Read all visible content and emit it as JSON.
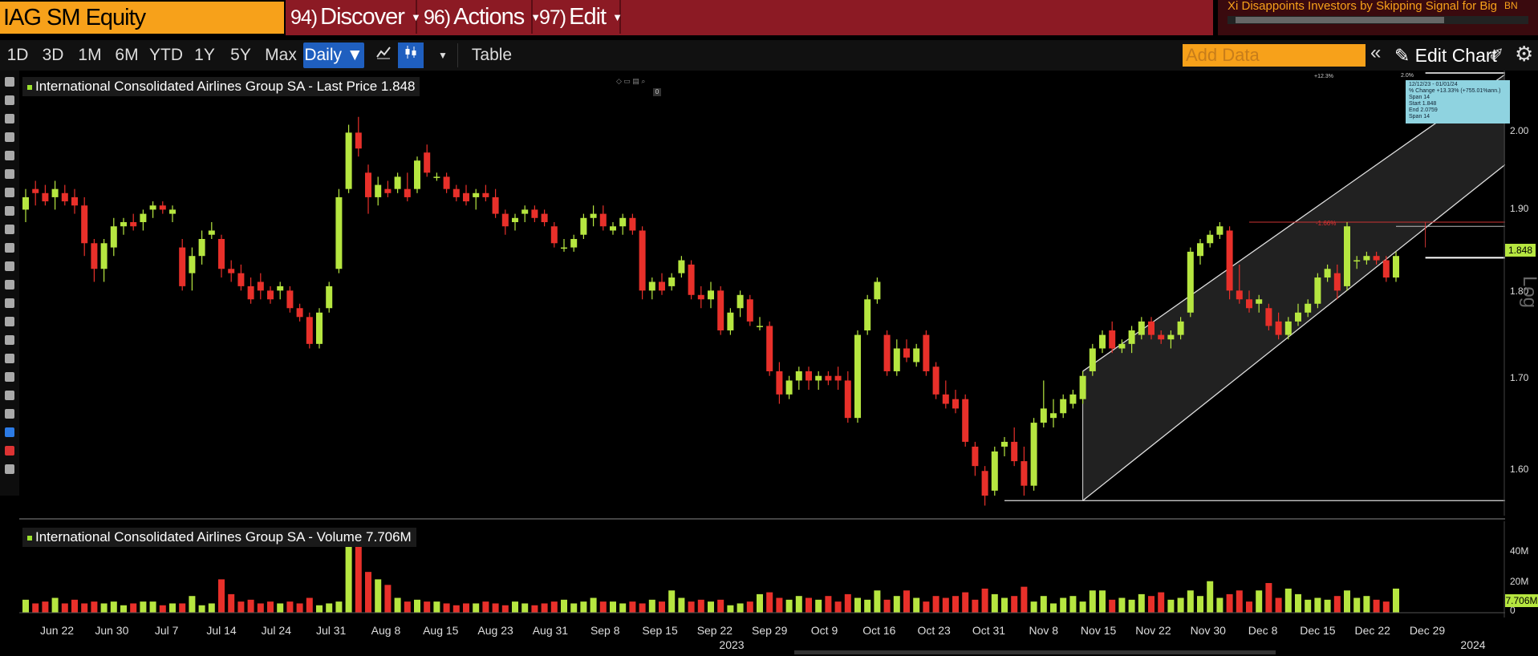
{
  "header": {
    "ticker": "IAG SM Equity",
    "menus": [
      {
        "num": "94)",
        "label": "Discover"
      },
      {
        "num": "96)",
        "label": "Actions"
      },
      {
        "num": "97)",
        "label": "Edit"
      }
    ],
    "news_headline": "Xi Disappoints Investors by Skipping Signal for Big ...",
    "news_badge": "BN"
  },
  "toolbar": {
    "ranges": [
      "1D",
      "3D",
      "1M",
      "6M",
      "YTD",
      "1Y",
      "5Y",
      "Max"
    ],
    "frequency": "Daily",
    "table_label": "Table",
    "add_data_placeholder": "Add Data",
    "edit_chart_label": "Edit Chart"
  },
  "main_legend": "International Consolidated Airlines Group SA - Last Price 1.848",
  "volume_legend": "International Consolidated Airlines Group SA - Volume 7.706M",
  "price_axis": {
    "ticks": [
      "2.00",
      "1.90",
      "1.80",
      "1.70",
      "1.60"
    ],
    "last_price": "1.848",
    "scale_label": "Log"
  },
  "volume_axis": {
    "ticks": [
      "40M",
      "20M",
      "0"
    ],
    "last_volume": "7.706M"
  },
  "measure_tool": {
    "header": "12/12/23 - 01/01/24",
    "lines": [
      "% Change +13.33% (+755.01%ann.) Span 14",
      "Start 1.848",
      "End 2.0759",
      "Span 14"
    ],
    "span_label": "2.0%",
    "pct_label": "+12.3%",
    "red_pct": "-1.66%"
  },
  "x_axis": {
    "labels": [
      "Jun 22",
      "Jun 30",
      "Jul 7",
      "Jul 14",
      "Jul 24",
      "Jul 31",
      "Aug 8",
      "Aug 15",
      "Aug 23",
      "Aug 31",
      "Sep 8",
      "Sep 15",
      "Sep 22",
      "Sep 29",
      "Oct 9",
      "Oct 16",
      "Oct 23",
      "Oct 31",
      "Nov 8",
      "Nov 15",
      "Nov 22",
      "Nov 30",
      "Dec 8",
      "Dec 15",
      "Dec 22",
      "Dec 29"
    ],
    "years": [
      "2023",
      "2024"
    ]
  },
  "colors": {
    "up": "#b6e640",
    "down": "#e8302a",
    "accent": "#f7a11a",
    "menu_bg": "#8c1a24"
  },
  "chart_data": {
    "type": "candlestick",
    "ylim": [
      1.57,
      2.08
    ],
    "series": [
      {
        "o": 1.905,
        "h": 1.93,
        "l": 1.89,
        "c": 1.92
      },
      {
        "o": 1.93,
        "h": 1.94,
        "l": 1.91,
        "c": 1.925
      },
      {
        "o": 1.925,
        "h": 1.935,
        "l": 1.91,
        "c": 1.915
      },
      {
        "o": 1.92,
        "h": 1.94,
        "l": 1.905,
        "c": 1.93
      },
      {
        "o": 1.925,
        "h": 1.935,
        "l": 1.91,
        "c": 1.915
      },
      {
        "o": 1.92,
        "h": 1.93,
        "l": 1.9,
        "c": 1.91
      },
      {
        "o": 1.91,
        "h": 1.92,
        "l": 1.85,
        "c": 1.865
      },
      {
        "o": 1.865,
        "h": 1.87,
        "l": 1.82,
        "c": 1.835
      },
      {
        "o": 1.835,
        "h": 1.87,
        "l": 1.82,
        "c": 1.865
      },
      {
        "o": 1.86,
        "h": 1.895,
        "l": 1.85,
        "c": 1.885
      },
      {
        "o": 1.885,
        "h": 1.895,
        "l": 1.875,
        "c": 1.89
      },
      {
        "o": 1.89,
        "h": 1.9,
        "l": 1.88,
        "c": 1.885
      },
      {
        "o": 1.89,
        "h": 1.905,
        "l": 1.88,
        "c": 1.9
      },
      {
        "o": 1.905,
        "h": 1.915,
        "l": 1.895,
        "c": 1.91
      },
      {
        "o": 1.91,
        "h": 1.915,
        "l": 1.9,
        "c": 1.905
      },
      {
        "o": 1.9,
        "h": 1.91,
        "l": 1.89,
        "c": 1.905
      },
      {
        "o": 1.86,
        "h": 1.87,
        "l": 1.81,
        "c": 1.815
      },
      {
        "o": 1.83,
        "h": 1.86,
        "l": 1.81,
        "c": 1.85
      },
      {
        "o": 1.85,
        "h": 1.88,
        "l": 1.84,
        "c": 1.87
      },
      {
        "o": 1.875,
        "h": 1.89,
        "l": 1.87,
        "c": 1.88
      },
      {
        "o": 1.87,
        "h": 1.875,
        "l": 1.825,
        "c": 1.835
      },
      {
        "o": 1.835,
        "h": 1.845,
        "l": 1.82,
        "c": 1.83
      },
      {
        "o": 1.83,
        "h": 1.84,
        "l": 1.81,
        "c": 1.815
      },
      {
        "o": 1.815,
        "h": 1.825,
        "l": 1.795,
        "c": 1.8
      },
      {
        "o": 1.82,
        "h": 1.83,
        "l": 1.8,
        "c": 1.81
      },
      {
        "o": 1.81,
        "h": 1.815,
        "l": 1.795,
        "c": 1.8
      },
      {
        "o": 1.81,
        "h": 1.82,
        "l": 1.8,
        "c": 1.815
      },
      {
        "o": 1.81,
        "h": 1.815,
        "l": 1.785,
        "c": 1.79
      },
      {
        "o": 1.79,
        "h": 1.795,
        "l": 1.775,
        "c": 1.78
      },
      {
        "o": 1.78,
        "h": 1.785,
        "l": 1.745,
        "c": 1.75
      },
      {
        "o": 1.75,
        "h": 1.79,
        "l": 1.745,
        "c": 1.785
      },
      {
        "o": 1.79,
        "h": 1.82,
        "l": 1.785,
        "c": 1.815
      },
      {
        "o": 1.835,
        "h": 1.93,
        "l": 1.83,
        "c": 1.92
      },
      {
        "o": 1.93,
        "h": 2.01,
        "l": 1.925,
        "c": 2.0
      },
      {
        "o": 2.0,
        "h": 2.02,
        "l": 1.97,
        "c": 1.98
      },
      {
        "o": 1.95,
        "h": 1.96,
        "l": 1.9,
        "c": 1.92
      },
      {
        "o": 1.92,
        "h": 1.945,
        "l": 1.91,
        "c": 1.935
      },
      {
        "o": 1.93,
        "h": 1.94,
        "l": 1.92,
        "c": 1.925
      },
      {
        "o": 1.93,
        "h": 1.95,
        "l": 1.925,
        "c": 1.945
      },
      {
        "o": 1.93,
        "h": 1.95,
        "l": 1.915,
        "c": 1.92
      },
      {
        "o": 1.93,
        "h": 1.97,
        "l": 1.925,
        "c": 1.965
      },
      {
        "o": 1.975,
        "h": 1.985,
        "l": 1.945,
        "c": 1.95
      },
      {
        "o": 1.945,
        "h": 1.95,
        "l": 1.94,
        "c": 1.945
      },
      {
        "o": 1.945,
        "h": 1.95,
        "l": 1.925,
        "c": 1.93
      },
      {
        "o": 1.93,
        "h": 1.935,
        "l": 1.915,
        "c": 1.92
      },
      {
        "o": 1.925,
        "h": 1.935,
        "l": 1.91,
        "c": 1.915
      },
      {
        "o": 1.92,
        "h": 1.93,
        "l": 1.905,
        "c": 1.925
      },
      {
        "o": 1.925,
        "h": 1.935,
        "l": 1.915,
        "c": 1.92
      },
      {
        "o": 1.92,
        "h": 1.93,
        "l": 1.895,
        "c": 1.9
      },
      {
        "o": 1.9,
        "h": 1.905,
        "l": 1.875,
        "c": 1.885
      },
      {
        "o": 1.89,
        "h": 1.9,
        "l": 1.88,
        "c": 1.895
      },
      {
        "o": 1.9,
        "h": 1.91,
        "l": 1.89,
        "c": 1.905
      },
      {
        "o": 1.905,
        "h": 1.91,
        "l": 1.89,
        "c": 1.895
      },
      {
        "o": 1.9,
        "h": 1.905,
        "l": 1.885,
        "c": 1.89
      },
      {
        "o": 1.885,
        "h": 1.89,
        "l": 1.86,
        "c": 1.865
      },
      {
        "o": 1.86,
        "h": 1.87,
        "l": 1.855,
        "c": 1.86
      },
      {
        "o": 1.86,
        "h": 1.875,
        "l": 1.855,
        "c": 1.87
      },
      {
        "o": 1.875,
        "h": 1.9,
        "l": 1.87,
        "c": 1.895
      },
      {
        "o": 1.895,
        "h": 1.91,
        "l": 1.885,
        "c": 1.9
      },
      {
        "o": 1.9,
        "h": 1.91,
        "l": 1.88,
        "c": 1.885
      },
      {
        "o": 1.88,
        "h": 1.89,
        "l": 1.875,
        "c": 1.885
      },
      {
        "o": 1.885,
        "h": 1.9,
        "l": 1.875,
        "c": 1.895
      },
      {
        "o": 1.895,
        "h": 1.9,
        "l": 1.875,
        "c": 1.88
      },
      {
        "o": 1.88,
        "h": 1.885,
        "l": 1.8,
        "c": 1.81
      },
      {
        "o": 1.81,
        "h": 1.825,
        "l": 1.8,
        "c": 1.82
      },
      {
        "o": 1.82,
        "h": 1.83,
        "l": 1.805,
        "c": 1.81
      },
      {
        "o": 1.815,
        "h": 1.83,
        "l": 1.81,
        "c": 1.825
      },
      {
        "o": 1.83,
        "h": 1.85,
        "l": 1.825,
        "c": 1.845
      },
      {
        "o": 1.84,
        "h": 1.845,
        "l": 1.8,
        "c": 1.805
      },
      {
        "o": 1.805,
        "h": 1.815,
        "l": 1.79,
        "c": 1.8
      },
      {
        "o": 1.8,
        "h": 1.82,
        "l": 1.79,
        "c": 1.81
      },
      {
        "o": 1.81,
        "h": 1.815,
        "l": 1.76,
        "c": 1.765
      },
      {
        "o": 1.765,
        "h": 1.79,
        "l": 1.76,
        "c": 1.785
      },
      {
        "o": 1.79,
        "h": 1.81,
        "l": 1.78,
        "c": 1.805
      },
      {
        "o": 1.8,
        "h": 1.805,
        "l": 1.77,
        "c": 1.775
      },
      {
        "o": 1.77,
        "h": 1.78,
        "l": 1.765,
        "c": 1.77
      },
      {
        "o": 1.77,
        "h": 1.775,
        "l": 1.715,
        "c": 1.72
      },
      {
        "o": 1.72,
        "h": 1.73,
        "l": 1.685,
        "c": 1.695
      },
      {
        "o": 1.695,
        "h": 1.715,
        "l": 1.69,
        "c": 1.71
      },
      {
        "o": 1.71,
        "h": 1.725,
        "l": 1.7,
        "c": 1.72
      },
      {
        "o": 1.72,
        "h": 1.725,
        "l": 1.7,
        "c": 1.71
      },
      {
        "o": 1.71,
        "h": 1.72,
        "l": 1.7,
        "c": 1.715
      },
      {
        "o": 1.715,
        "h": 1.72,
        "l": 1.705,
        "c": 1.71
      },
      {
        "o": 1.715,
        "h": 1.725,
        "l": 1.7,
        "c": 1.71
      },
      {
        "o": 1.71,
        "h": 1.72,
        "l": 1.665,
        "c": 1.67
      },
      {
        "o": 1.67,
        "h": 1.765,
        "l": 1.665,
        "c": 1.76
      },
      {
        "o": 1.765,
        "h": 1.805,
        "l": 1.76,
        "c": 1.8
      },
      {
        "o": 1.8,
        "h": 1.825,
        "l": 1.795,
        "c": 1.82
      },
      {
        "o": 1.76,
        "h": 1.765,
        "l": 1.715,
        "c": 1.72
      },
      {
        "o": 1.72,
        "h": 1.755,
        "l": 1.715,
        "c": 1.745
      },
      {
        "o": 1.745,
        "h": 1.755,
        "l": 1.73,
        "c": 1.735
      },
      {
        "o": 1.73,
        "h": 1.75,
        "l": 1.725,
        "c": 1.745
      },
      {
        "o": 1.76,
        "h": 1.765,
        "l": 1.715,
        "c": 1.72
      },
      {
        "o": 1.725,
        "h": 1.73,
        "l": 1.69,
        "c": 1.695
      },
      {
        "o": 1.695,
        "h": 1.71,
        "l": 1.68,
        "c": 1.685
      },
      {
        "o": 1.69,
        "h": 1.7,
        "l": 1.675,
        "c": 1.68
      },
      {
        "o": 1.69,
        "h": 1.695,
        "l": 1.64,
        "c": 1.645
      },
      {
        "o": 1.64,
        "h": 1.645,
        "l": 1.61,
        "c": 1.62
      },
      {
        "o": 1.615,
        "h": 1.62,
        "l": 1.58,
        "c": 1.59
      },
      {
        "o": 1.595,
        "h": 1.64,
        "l": 1.59,
        "c": 1.635
      },
      {
        "o": 1.64,
        "h": 1.65,
        "l": 1.63,
        "c": 1.645
      },
      {
        "o": 1.645,
        "h": 1.66,
        "l": 1.62,
        "c": 1.625
      },
      {
        "o": 1.625,
        "h": 1.64,
        "l": 1.59,
        "c": 1.6
      },
      {
        "o": 1.6,
        "h": 1.67,
        "l": 1.595,
        "c": 1.665
      },
      {
        "o": 1.665,
        "h": 1.71,
        "l": 1.66,
        "c": 1.68
      },
      {
        "o": 1.67,
        "h": 1.69,
        "l": 1.66,
        "c": 1.675
      },
      {
        "o": 1.675,
        "h": 1.695,
        "l": 1.67,
        "c": 1.69
      },
      {
        "o": 1.685,
        "h": 1.7,
        "l": 1.68,
        "c": 1.695
      },
      {
        "o": 1.69,
        "h": 1.72,
        "l": 1.685,
        "c": 1.715
      },
      {
        "o": 1.72,
        "h": 1.75,
        "l": 1.715,
        "c": 1.745
      },
      {
        "o": 1.745,
        "h": 1.765,
        "l": 1.74,
        "c": 1.76
      },
      {
        "o": 1.765,
        "h": 1.775,
        "l": 1.74,
        "c": 1.745
      },
      {
        "o": 1.745,
        "h": 1.755,
        "l": 1.74,
        "c": 1.75
      },
      {
        "o": 1.75,
        "h": 1.77,
        "l": 1.74,
        "c": 1.765
      },
      {
        "o": 1.76,
        "h": 1.78,
        "l": 1.755,
        "c": 1.775
      },
      {
        "o": 1.775,
        "h": 1.78,
        "l": 1.755,
        "c": 1.76
      },
      {
        "o": 1.76,
        "h": 1.765,
        "l": 1.75,
        "c": 1.755
      },
      {
        "o": 1.755,
        "h": 1.765,
        "l": 1.745,
        "c": 1.76
      },
      {
        "o": 1.76,
        "h": 1.78,
        "l": 1.755,
        "c": 1.775
      },
      {
        "o": 1.785,
        "h": 1.86,
        "l": 1.78,
        "c": 1.855
      },
      {
        "o": 1.85,
        "h": 1.87,
        "l": 1.84,
        "c": 1.865
      },
      {
        "o": 1.865,
        "h": 1.88,
        "l": 1.86,
        "c": 1.875
      },
      {
        "o": 1.875,
        "h": 1.89,
        "l": 1.87,
        "c": 1.885
      },
      {
        "o": 1.88,
        "h": 1.885,
        "l": 1.8,
        "c": 1.81
      },
      {
        "o": 1.81,
        "h": 1.84,
        "l": 1.795,
        "c": 1.8
      },
      {
        "o": 1.8,
        "h": 1.81,
        "l": 1.785,
        "c": 1.79
      },
      {
        "o": 1.795,
        "h": 1.805,
        "l": 1.785,
        "c": 1.8
      },
      {
        "o": 1.79,
        "h": 1.795,
        "l": 1.765,
        "c": 1.77
      },
      {
        "o": 1.775,
        "h": 1.785,
        "l": 1.755,
        "c": 1.76
      },
      {
        "o": 1.76,
        "h": 1.78,
        "l": 1.755,
        "c": 1.775
      },
      {
        "o": 1.775,
        "h": 1.795,
        "l": 1.77,
        "c": 1.785
      },
      {
        "o": 1.785,
        "h": 1.8,
        "l": 1.78,
        "c": 1.795
      },
      {
        "o": 1.795,
        "h": 1.83,
        "l": 1.79,
        "c": 1.825
      },
      {
        "o": 1.825,
        "h": 1.84,
        "l": 1.82,
        "c": 1.835
      },
      {
        "o": 1.83,
        "h": 1.84,
        "l": 1.8,
        "c": 1.81
      },
      {
        "o": 1.815,
        "h": 1.89,
        "l": 1.81,
        "c": 1.885
      },
      {
        "o": 1.845,
        "h": 1.85,
        "l": 1.835,
        "c": 1.845
      },
      {
        "o": 1.845,
        "h": 1.855,
        "l": 1.84,
        "c": 1.85
      },
      {
        "o": 1.85,
        "h": 1.855,
        "l": 1.84,
        "c": 1.845
      },
      {
        "o": 1.845,
        "h": 1.85,
        "l": 1.82,
        "c": 1.825
      },
      {
        "o": 1.825,
        "h": 1.855,
        "l": 1.82,
        "c": 1.85
      }
    ],
    "volume": [
      7,
      5,
      6,
      8,
      5,
      7,
      5,
      6,
      5,
      6,
      4,
      5,
      6,
      6,
      4,
      5,
      5,
      9,
      4,
      5,
      18,
      10,
      6,
      7,
      5,
      6,
      5,
      6,
      5,
      8,
      4,
      5,
      6,
      40,
      38,
      22,
      18,
      15,
      8,
      6,
      7,
      6,
      6,
      5,
      4,
      5,
      5,
      6,
      5,
      4,
      6,
      5,
      4,
      5,
      6,
      7,
      5,
      6,
      8,
      6,
      6,
      5,
      6,
      5,
      7,
      6,
      12,
      8,
      6,
      7,
      6,
      7,
      4,
      5,
      6,
      10,
      11,
      8,
      7,
      9,
      8,
      7,
      9,
      6,
      10,
      8,
      7,
      12,
      7,
      9,
      12,
      8,
      6,
      9,
      8,
      9,
      11,
      7,
      13,
      10,
      8,
      9,
      14,
      6,
      9,
      5,
      8,
      9,
      6,
      12,
      12,
      7,
      8,
      7,
      10,
      9,
      11,
      7,
      8,
      12,
      9,
      17,
      8,
      10,
      12,
      6,
      12,
      16,
      8,
      13,
      10,
      7,
      8,
      7,
      9,
      12,
      8,
      9,
      7,
      6,
      13,
      11,
      10,
      8,
      7,
      6
    ],
    "volume_ylim": [
      0,
      45
    ],
    "up_flags_from_price": true,
    "channel": {
      "start_index": 108,
      "end_index": 168,
      "lower_start": 1.585,
      "lower_end": 1.96,
      "upper_start": 1.72,
      "upper_end": 2.075
    },
    "support_line": 1.585,
    "resistance_line": 1.89,
    "last_price_line": 1.848
  }
}
